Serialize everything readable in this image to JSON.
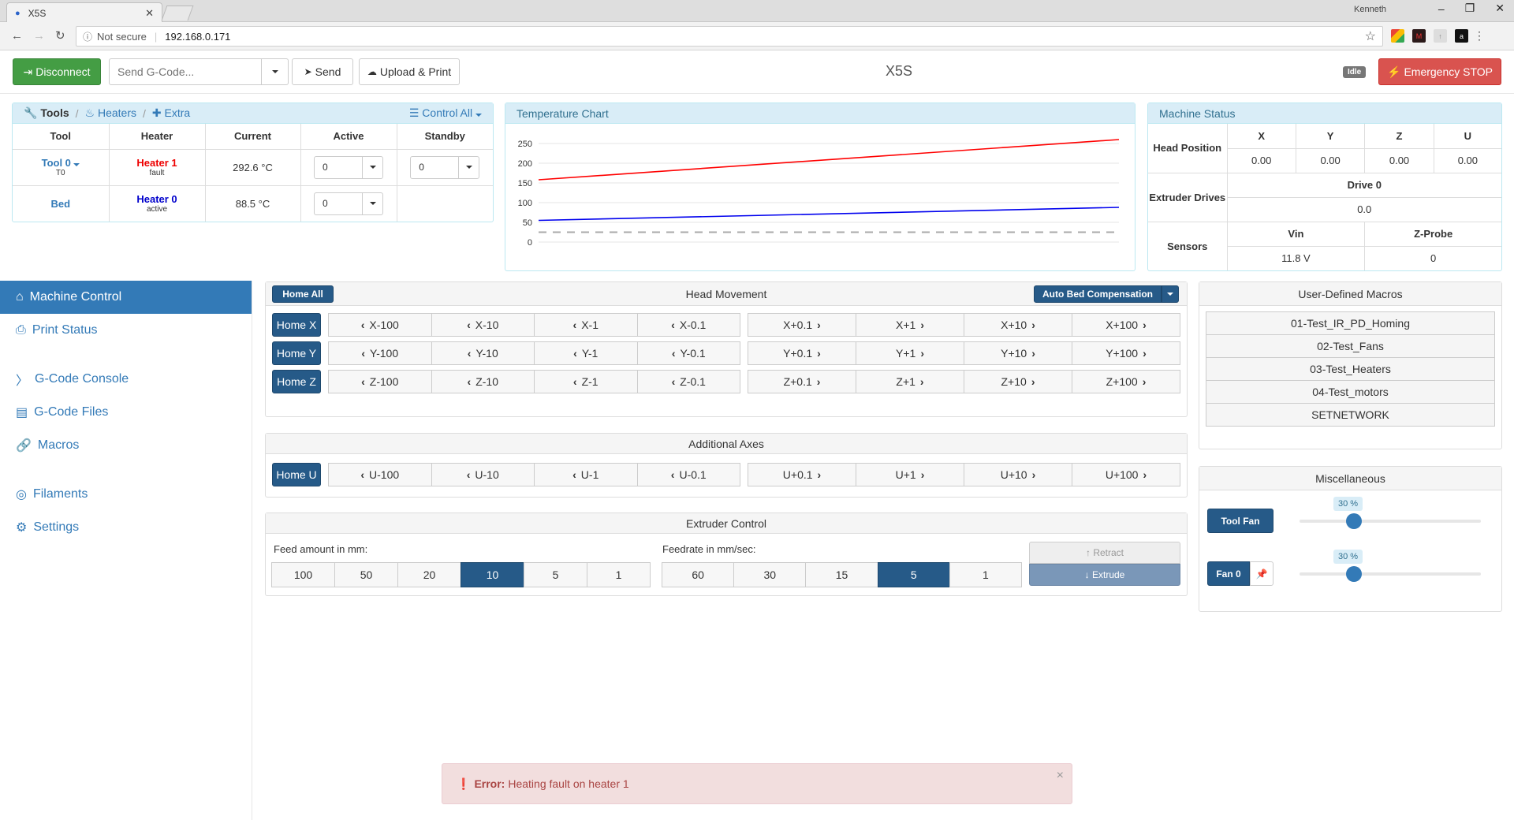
{
  "browser": {
    "tab_title": "X5S",
    "security_label": "Not secure",
    "url": "192.168.0.171",
    "user": "Kenneth"
  },
  "header": {
    "disconnect_label": "Disconnect",
    "gcode_placeholder": "Send G-Code...",
    "send_label": "Send",
    "upload_label": "Upload & Print",
    "machine_name": "X5S",
    "status_badge": "Idle",
    "estop_label": "Emergency STOP"
  },
  "tools_panel": {
    "tab_tools": "Tools",
    "tab_heaters": "Heaters",
    "tab_extra": "Extra",
    "control_all": "Control All",
    "columns": [
      "Tool",
      "Heater",
      "Current",
      "Active",
      "Standby"
    ],
    "rows": [
      {
        "tool": "Tool 0",
        "tool_sub": "T0",
        "heater": "Heater 1",
        "heater_state": "fault",
        "current": "292.6 °C",
        "active": "0",
        "standby": "0"
      },
      {
        "tool": "Bed",
        "tool_sub": "",
        "heater": "Heater 0",
        "heater_state": "active",
        "current": "88.5 °C",
        "active": "0",
        "standby": ""
      }
    ]
  },
  "temp_chart": {
    "title": "Temperature Chart"
  },
  "chart_data": {
    "type": "line",
    "title": "",
    "ylim": [
      0,
      250
    ],
    "yticks": [
      0,
      50,
      100,
      150,
      200,
      250
    ],
    "grid": true,
    "x": [
      0,
      1
    ],
    "series": [
      {
        "values": [
          158,
          290
        ],
        "color": "#ff0000"
      },
      {
        "values": [
          55,
          88
        ],
        "color": "#0000ee"
      },
      {
        "values": [
          25,
          25
        ],
        "color": "#aaaaaa",
        "dashed": true
      }
    ]
  },
  "machine_status": {
    "title": "Machine Status",
    "head_position_label": "Head Position",
    "axes": [
      "X",
      "Y",
      "Z",
      "U"
    ],
    "positions": [
      "0.00",
      "0.00",
      "0.00",
      "0.00"
    ],
    "extruder_label": "Extruder Drives",
    "drive_name": "Drive 0",
    "drive_value": "0.0",
    "sensors_label": "Sensors",
    "vin_label": "Vin",
    "vin_value": "11.8 V",
    "zprobe_label": "Z-Probe",
    "zprobe_value": "0"
  },
  "sidebar": {
    "items": [
      {
        "label": "Machine Control",
        "icon": "home-icon"
      },
      {
        "label": "Print Status",
        "icon": "print-icon"
      },
      {
        "label": "G-Code Console",
        "icon": "console-icon"
      },
      {
        "label": "G-Code Files",
        "icon": "files-icon"
      },
      {
        "label": "Macros",
        "icon": "macros-icon"
      },
      {
        "label": "Filaments",
        "icon": "filaments-icon"
      },
      {
        "label": "Settings",
        "icon": "settings-icon"
      }
    ]
  },
  "head_movement": {
    "title": "Head Movement",
    "home_all": "Home All",
    "auto_bed": "Auto Bed Compensation",
    "rows": [
      {
        "home": "Home X",
        "neg": [
          "X-100",
          "X-10",
          "X-1",
          "X-0.1"
        ],
        "pos": [
          "X+0.1",
          "X+1",
          "X+10",
          "X+100"
        ]
      },
      {
        "home": "Home Y",
        "neg": [
          "Y-100",
          "Y-10",
          "Y-1",
          "Y-0.1"
        ],
        "pos": [
          "Y+0.1",
          "Y+1",
          "Y+10",
          "Y+100"
        ]
      },
      {
        "home": "Home Z",
        "neg": [
          "Z-100",
          "Z-10",
          "Z-1",
          "Z-0.1"
        ],
        "pos": [
          "Z+0.1",
          "Z+1",
          "Z+10",
          "Z+100"
        ]
      }
    ]
  },
  "additional_axes": {
    "title": "Additional Axes",
    "home": "Home U",
    "neg": [
      "U-100",
      "U-10",
      "U-1",
      "U-0.1"
    ],
    "pos": [
      "U+0.1",
      "U+1",
      "U+10",
      "U+100"
    ]
  },
  "extruder": {
    "title": "Extruder Control",
    "feed_label": "Feed amount in mm:",
    "feed_values": [
      "100",
      "50",
      "20",
      "10",
      "5",
      "1"
    ],
    "feed_selected": "10",
    "rate_label": "Feedrate in mm/sec:",
    "rate_values": [
      "60",
      "30",
      "15",
      "5",
      "1"
    ],
    "rate_selected": "5",
    "retract": "Retract",
    "extrude": "Extrude"
  },
  "macros": {
    "title": "User-Defined Macros",
    "items": [
      "01-Test_IR_PD_Homing",
      "02-Test_Fans",
      "03-Test_Heaters",
      "04-Test_motors",
      "SETNETWORK"
    ]
  },
  "misc": {
    "title": "Miscellaneous",
    "fans": [
      {
        "label": "Tool Fan",
        "percent": "30 %",
        "level": 0.3
      },
      {
        "label": "Fan 0",
        "percent": "30 %",
        "level": 0.3
      }
    ]
  },
  "alert": {
    "prefix": "Error:",
    "message": "Heating fault on heater 1"
  }
}
